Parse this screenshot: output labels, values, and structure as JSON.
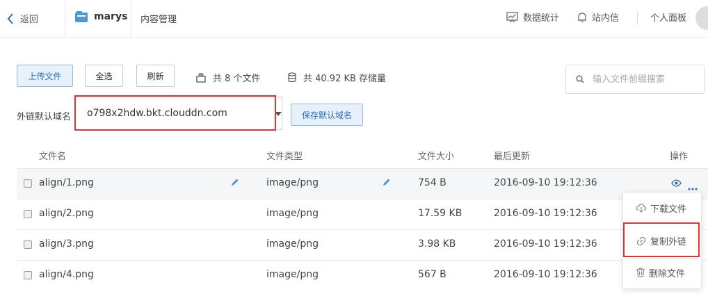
{
  "header": {
    "back_label": "返回",
    "bucket_name": "marys",
    "section": "内容管理",
    "nav": {
      "stats": "数据统计",
      "messages": "站内信",
      "panel": "个人面板"
    }
  },
  "toolbar": {
    "upload": "上传文件",
    "select_all": "全选",
    "refresh": "刷新",
    "file_count": "共 8 个文件",
    "storage": "共 40.92 KB 存储量"
  },
  "search": {
    "placeholder": "输入文件前缀搜索"
  },
  "domain": {
    "label": "外链默认域名",
    "selected": "o798x2hdw.bkt.clouddn.com",
    "save_button": "保存默认域名"
  },
  "table": {
    "headers": {
      "name": "文件名",
      "type": "文件类型",
      "size": "文件大小",
      "updated": "最后更新",
      "actions": "操作"
    },
    "rows": [
      {
        "name": "align/1.png",
        "type": "image/png",
        "size": "754 B",
        "updated": "2016-09-10 19:12:36"
      },
      {
        "name": "align/2.png",
        "type": "image/png",
        "size": "17.59 KB",
        "updated": "2016-09-10 19:12:36"
      },
      {
        "name": "align/3.png",
        "type": "image/png",
        "size": "3.98 KB",
        "updated": "2016-09-10 19:12:36"
      },
      {
        "name": "align/4.png",
        "type": "image/png",
        "size": "567 B",
        "updated": "2016-09-10 19:12:36"
      }
    ]
  },
  "context_menu": {
    "download": "下载文件",
    "copy_link": "复制外链",
    "delete": "删除文件"
  },
  "colors": {
    "accent": "#2b6fb6",
    "highlight": "#e03434"
  }
}
